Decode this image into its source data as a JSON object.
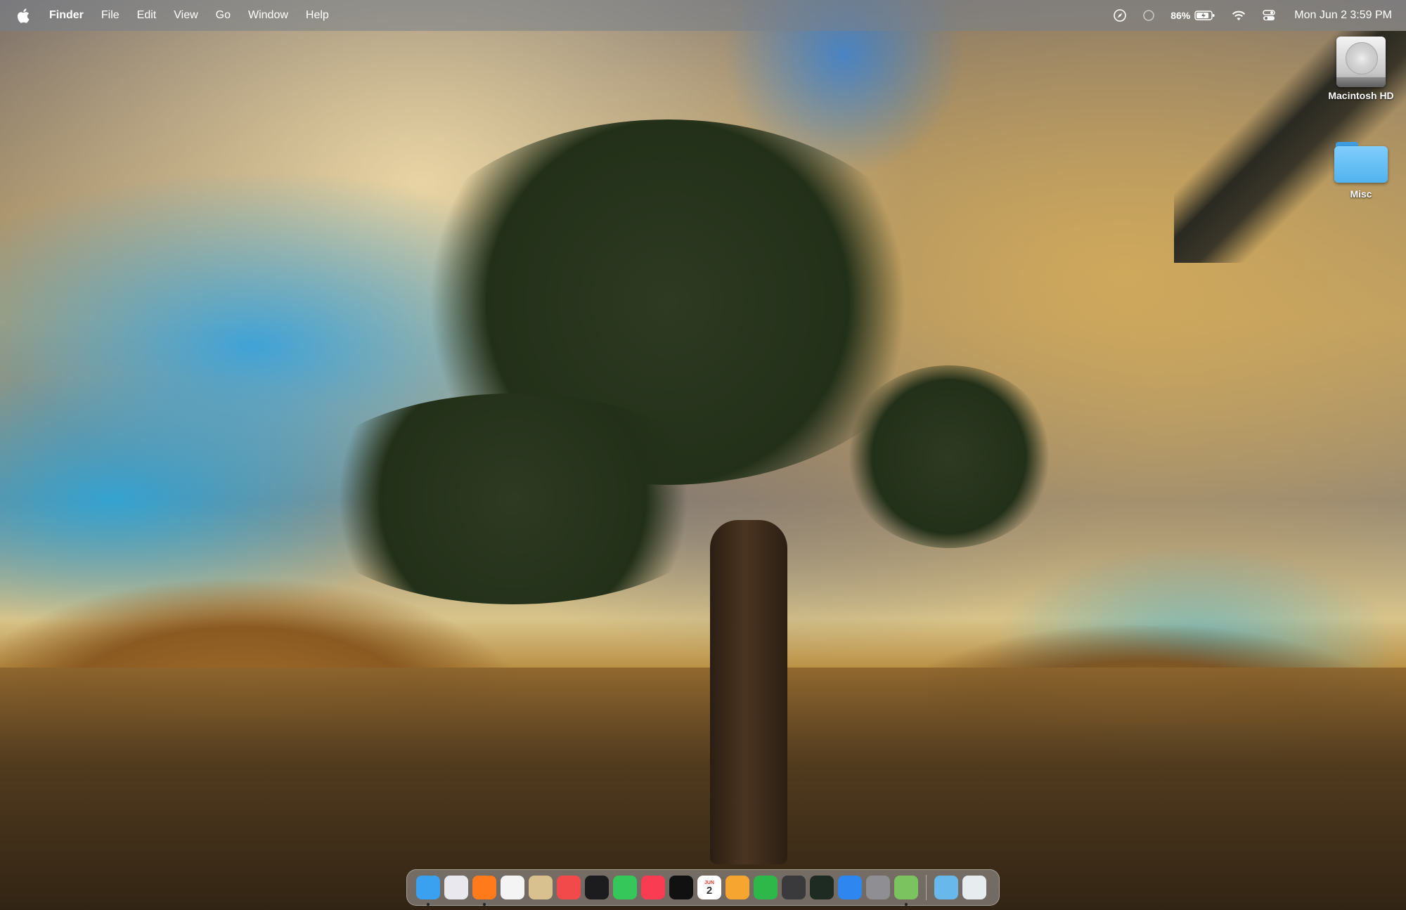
{
  "menubar": {
    "app_name": "Finder",
    "menus": [
      "File",
      "Edit",
      "View",
      "Go",
      "Window",
      "Help"
    ],
    "battery_percent": "86%",
    "clock": "Mon Jun 2  3:59 PM"
  },
  "desktop": {
    "items": [
      {
        "label": "Macintosh HD",
        "icon": "hard-drive-icon"
      },
      {
        "label": "Misc",
        "icon": "folder-icon"
      }
    ]
  },
  "dock": {
    "apps": [
      {
        "name": "finder",
        "color": "#3aa0f0",
        "running": true
      },
      {
        "name": "launchpad",
        "color": "#e8e8ee",
        "running": false
      },
      {
        "name": "firefox",
        "color": "#ff7a1a",
        "running": true
      },
      {
        "name": "textedit",
        "color": "#f4f4f4",
        "running": false
      },
      {
        "name": "color-ui",
        "color": "#d9c08f",
        "running": false
      },
      {
        "name": "news",
        "color": "#f24a4a",
        "running": false
      },
      {
        "name": "stocks",
        "color": "#1c1c1e",
        "running": false
      },
      {
        "name": "messages",
        "color": "#35c759",
        "running": false
      },
      {
        "name": "music",
        "color": "#fa3c52",
        "running": false
      },
      {
        "name": "apple-tv",
        "color": "#111111",
        "running": false
      },
      {
        "name": "calendar",
        "color": "#ffffff",
        "running": false,
        "month": "JUN",
        "day": "2"
      },
      {
        "name": "pages",
        "color": "#f7a531",
        "running": false
      },
      {
        "name": "numbers",
        "color": "#2fb84a",
        "running": false
      },
      {
        "name": "calculator",
        "color": "#3a3a3c",
        "running": false
      },
      {
        "name": "activity-monitor",
        "color": "#1d2b23",
        "running": false
      },
      {
        "name": "safari",
        "color": "#2e86f0",
        "running": false
      },
      {
        "name": "system-settings",
        "color": "#8e8e93",
        "running": false
      },
      {
        "name": "maps-like",
        "color": "#7ac35e",
        "running": true
      }
    ],
    "trailing": [
      {
        "name": "downloads-folder",
        "color": "#69b8ec"
      },
      {
        "name": "trash",
        "color": "#e7ecef"
      }
    ]
  }
}
